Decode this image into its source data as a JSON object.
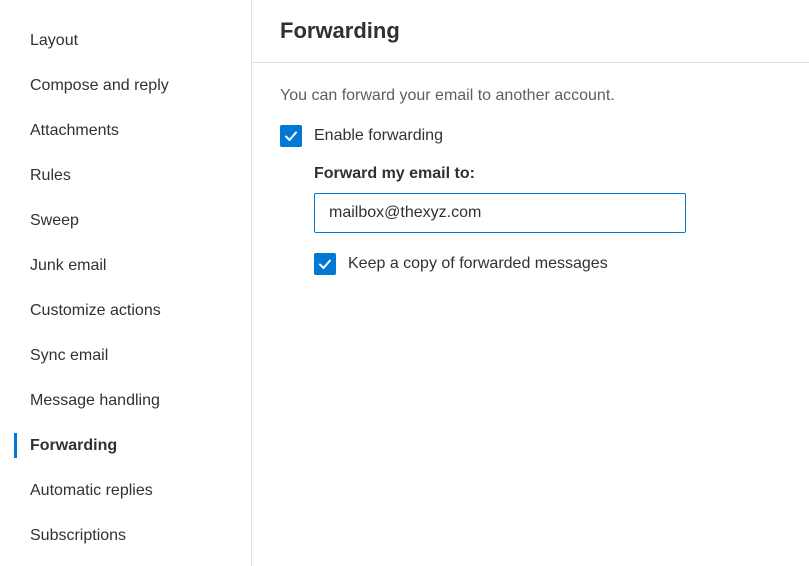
{
  "sidebar": {
    "items": [
      {
        "label": "Layout",
        "active": false
      },
      {
        "label": "Compose and reply",
        "active": false
      },
      {
        "label": "Attachments",
        "active": false
      },
      {
        "label": "Rules",
        "active": false
      },
      {
        "label": "Sweep",
        "active": false
      },
      {
        "label": "Junk email",
        "active": false
      },
      {
        "label": "Customize actions",
        "active": false
      },
      {
        "label": "Sync email",
        "active": false
      },
      {
        "label": "Message handling",
        "active": false
      },
      {
        "label": "Forwarding",
        "active": true
      },
      {
        "label": "Automatic replies",
        "active": false
      },
      {
        "label": "Subscriptions",
        "active": false
      }
    ]
  },
  "main": {
    "title": "Forwarding",
    "description": "You can forward your email to another account.",
    "enable_label": "Enable forwarding",
    "enable_checked": true,
    "forward_to_label": "Forward my email to:",
    "forward_to_value": "mailbox@thexyz.com",
    "keep_copy_label": "Keep a copy of forwarded messages",
    "keep_copy_checked": true
  }
}
